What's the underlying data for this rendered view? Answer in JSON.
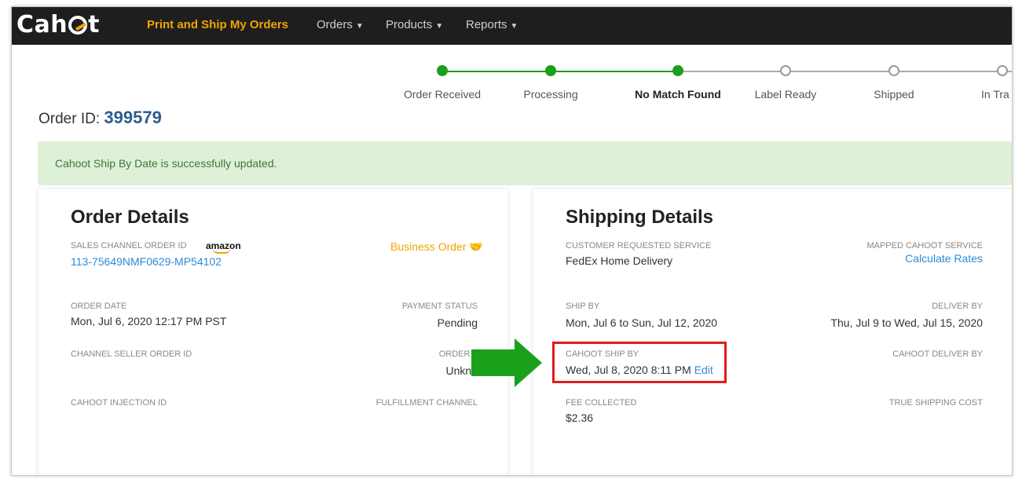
{
  "app": {
    "logo": "Cahoot"
  },
  "nav": {
    "items": [
      {
        "label": "Print and Ship My Orders"
      },
      {
        "label": "Orders"
      },
      {
        "label": "Products"
      },
      {
        "label": "Reports"
      }
    ]
  },
  "progress": {
    "steps": [
      {
        "label": "Order Received",
        "status": "done"
      },
      {
        "label": "Processing",
        "status": "done"
      },
      {
        "label": "No Match Found",
        "status": "current"
      },
      {
        "label": "Label Ready",
        "status": "pending"
      },
      {
        "label": "Shipped",
        "status": "pending"
      },
      {
        "label": "In Tra",
        "status": "pending"
      }
    ]
  },
  "order": {
    "id_label": "Order ID:",
    "id": "399579"
  },
  "alert": {
    "message": "Cahoot Ship By Date is successfully updated."
  },
  "order_details": {
    "title": "Order Details",
    "sales_channel_order_id_label": "SALES CHANNEL ORDER ID",
    "channel_logo": "amazon",
    "sales_channel_order_id": "113-75649NMF0629-MP54102",
    "business_order": "Business Order",
    "order_date_label": "ORDER DATE",
    "order_date": "Mon, Jul 6, 2020 12:17 PM PST",
    "payment_status_label": "PAYMENT STATUS",
    "payment_status": "Pending",
    "channel_seller_order_id_label": "CHANNEL SELLER ORDER ID",
    "order_type_label": "ORDER T",
    "order_type": "Unkno",
    "cahoot_injection_id_label": "CAHOOT INJECTION ID",
    "fulfillment_channel_label": "FULFILLMENT CHANNEL"
  },
  "shipping_details": {
    "title": "Shipping Details",
    "customer_requested_service_label": "CUSTOMER REQUESTED SERVICE",
    "customer_requested_service": "FedEx Home Delivery",
    "mapped_cahoot_service_label": "MAPPED CAHOOT SERVICE",
    "calculate_rates": "Calculate Rates",
    "ship_by_label": "SHIP BY",
    "ship_by": "Mon, Jul 6 to Sun, Jul 12, 2020",
    "deliver_by_label": "DELIVER BY",
    "deliver_by": "Thu, Jul 9 to Wed, Jul 15, 2020",
    "cahoot_ship_by_label": "CAHOOT SHIP BY",
    "cahoot_ship_by": "Wed, Jul 8, 2020 8:11 PM",
    "edit": "Edit",
    "cahoot_deliver_by_label": "CAHOOT DELIVER BY",
    "fee_collected_label": "FEE COLLECTED",
    "fee_collected": "$2.36",
    "true_shipping_cost_label": "TRUE SHIPPING COST"
  },
  "colors": {
    "accent": "#f0a500",
    "success": "#1aa01a",
    "link": "#2f8ad6",
    "highlight": "#e01c1c",
    "arrow": "#1aa01a"
  }
}
